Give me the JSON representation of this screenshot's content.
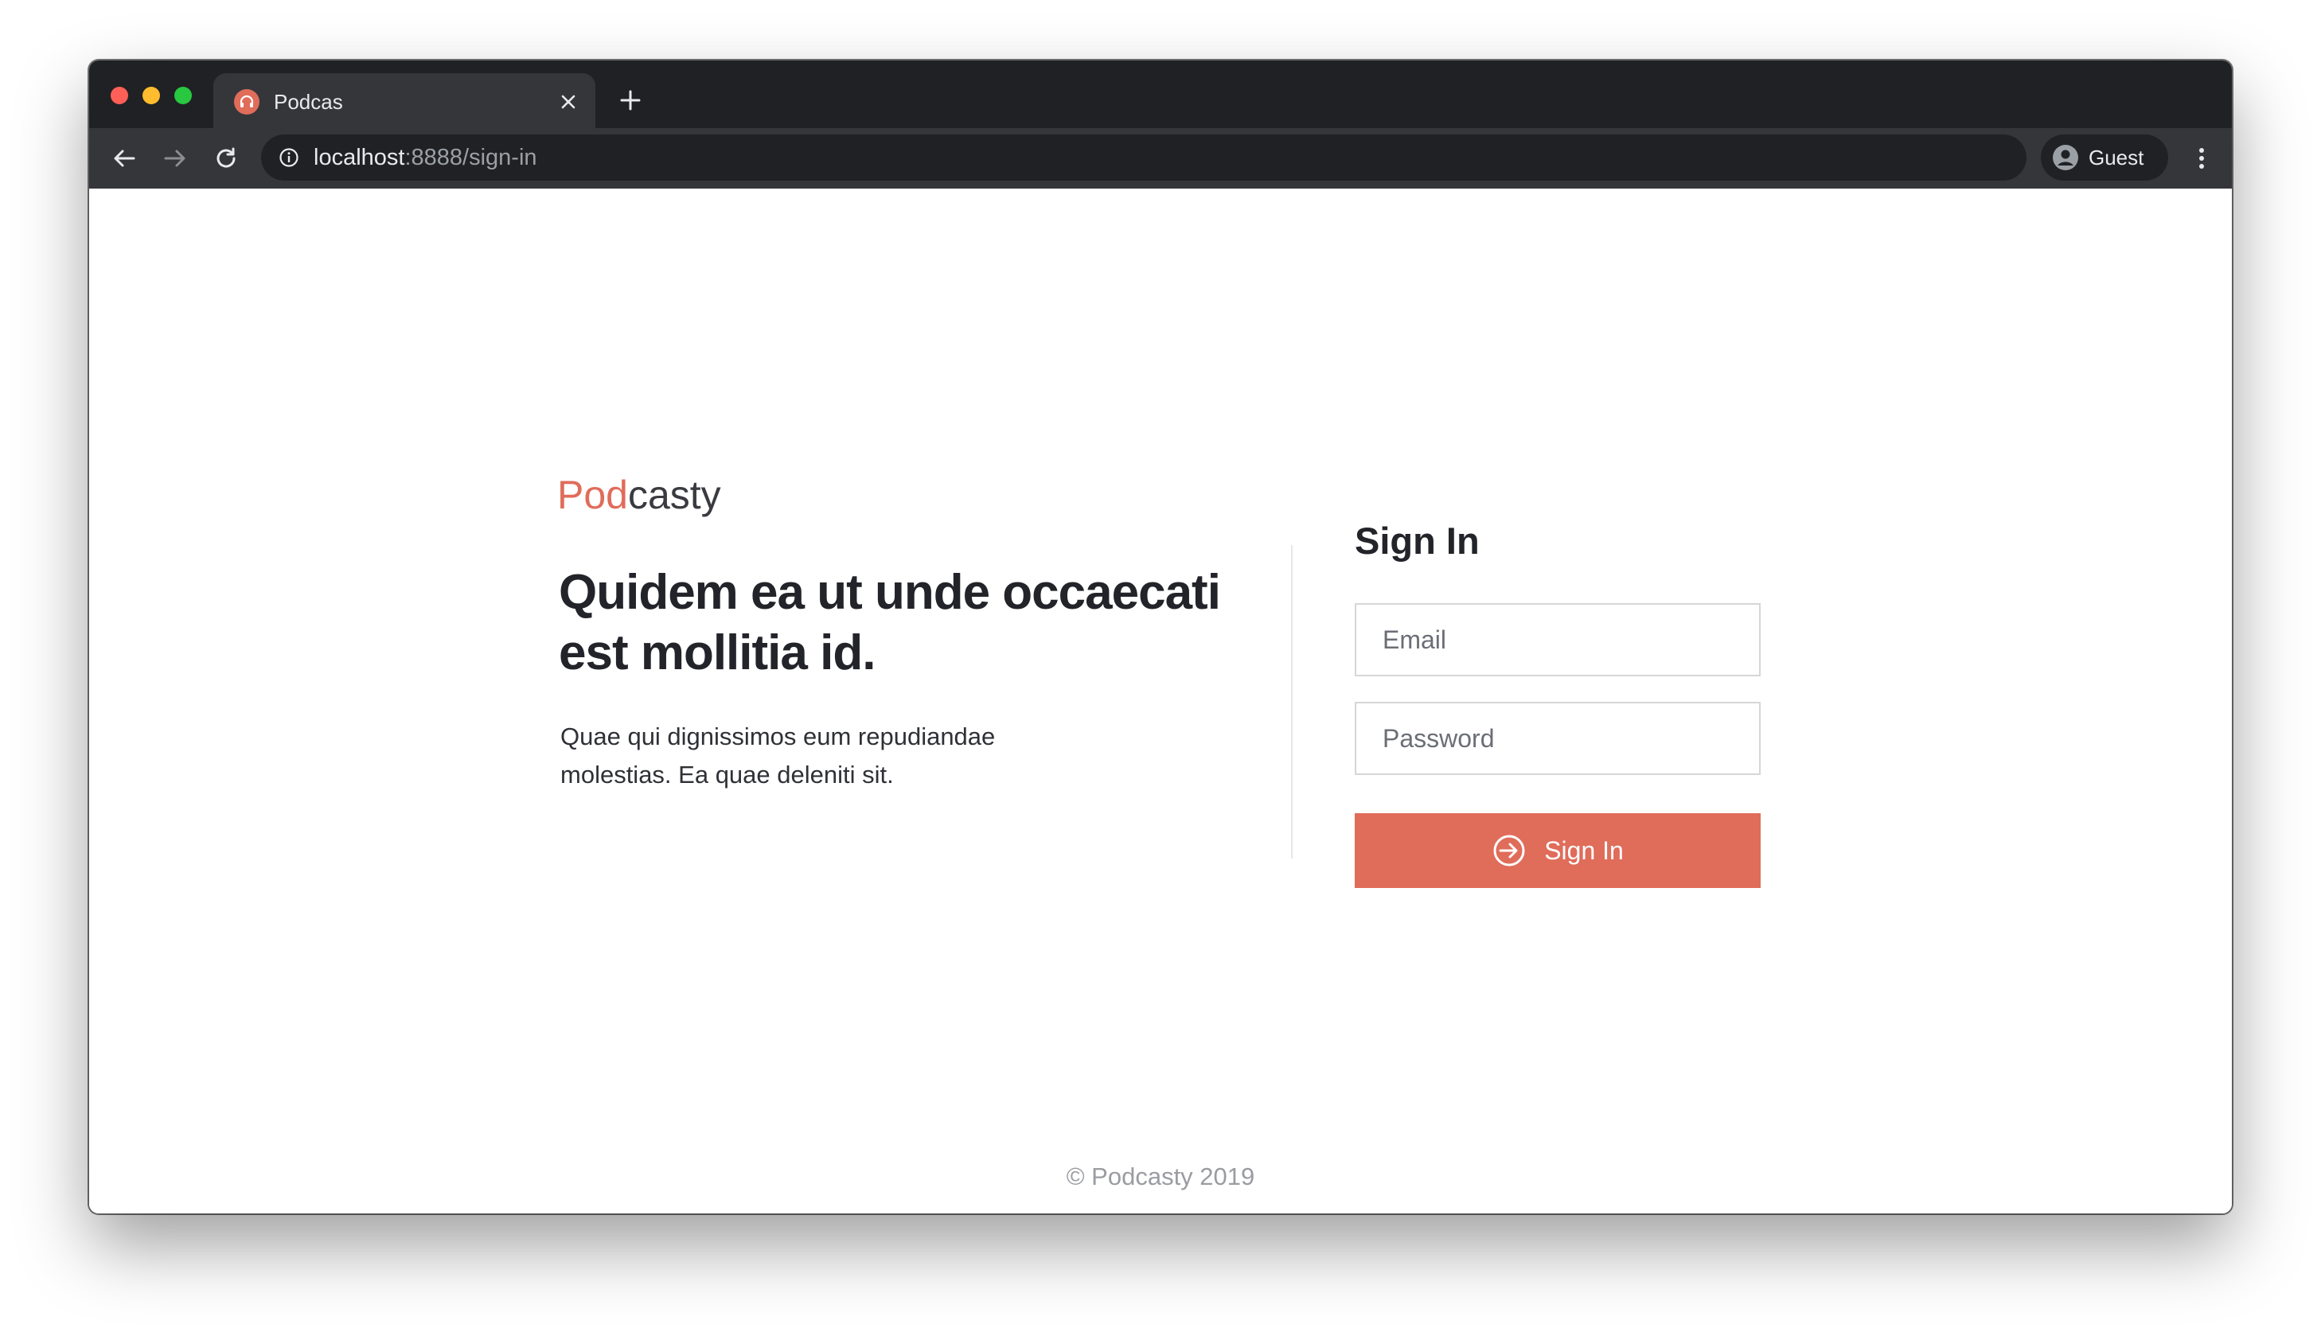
{
  "browser": {
    "tab_title": "Podcas",
    "tab_close_icon": "close-icon",
    "new_tab_label": "+",
    "url_host": "localhost",
    "url_rest": ":8888/sign-in",
    "profile_label": "Guest",
    "colors": {
      "frame": "#202124",
      "toolbar": "#35363a",
      "close": "#ff5f57",
      "minimize": "#febc2e",
      "maximize": "#28c840"
    }
  },
  "hero": {
    "logo_part1": "Pod",
    "logo_part2": "casty",
    "headline": "Quidem ea ut unde occaecati est mollitia id.",
    "subtext": "Quae qui dignissimos eum repudiandae molestias. Ea quae deleniti sit."
  },
  "signin": {
    "title": "Sign In",
    "email_placeholder": "Email",
    "password_placeholder": "Password",
    "button_label": "Sign In"
  },
  "footer": {
    "text": "© Podcasty 2019"
  },
  "colors": {
    "accent": "#e06c5a",
    "text_dark": "#23242a",
    "logo_dark": "#3a3b40"
  }
}
